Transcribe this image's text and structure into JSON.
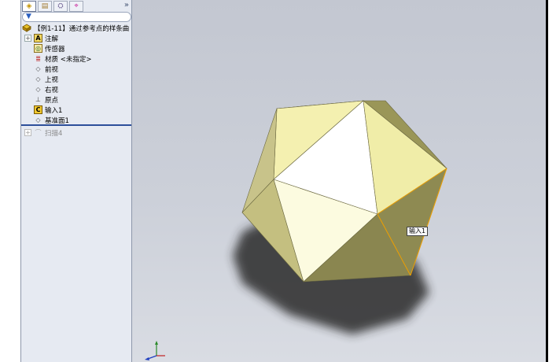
{
  "panel": {
    "tabs": [
      {
        "name": "featuremanager-tab-icon",
        "glyph": "◈"
      },
      {
        "name": "propertymanager-tab-icon",
        "glyph": "▤"
      },
      {
        "name": "configuration-tab-icon",
        "glyph": "⛭"
      },
      {
        "name": "dimxpert-tab-icon",
        "glyph": "⌖"
      }
    ],
    "expand_glyph": "»",
    "filter_icon": "▼"
  },
  "tree": {
    "root_label": "【例1-11】通过参考点的样条曲",
    "items": [
      {
        "label": "注解",
        "icon": "A",
        "expandable": true
      },
      {
        "label": "传感器",
        "icon": "◎",
        "expandable": false
      },
      {
        "label": "材质 <未指定>",
        "icon": "≣",
        "expandable": false
      },
      {
        "label": "前视",
        "icon": "◇",
        "expandable": false
      },
      {
        "label": "上视",
        "icon": "◇",
        "expandable": false
      },
      {
        "label": "右视",
        "icon": "◇",
        "expandable": false
      },
      {
        "label": "原点",
        "icon": "⊥",
        "expandable": false
      },
      {
        "label": "输入1",
        "icon": "C",
        "expandable": false
      },
      {
        "label": "基准面1",
        "icon": "◇",
        "expandable": false
      }
    ],
    "suppressed_item": {
      "label": "扫描4",
      "icon": "⌒",
      "expandable": true
    }
  },
  "viewport": {
    "tooltip": "输入1"
  },
  "colors": {
    "panel_bg": "#e6eaf2",
    "viewport_bg": "#c3c7d1",
    "rollback_bar": "#2d4f9a",
    "model_face_light": "#f6f2b6",
    "model_face_dark": "#8a8550",
    "highlight_edge": "#f0a000"
  }
}
